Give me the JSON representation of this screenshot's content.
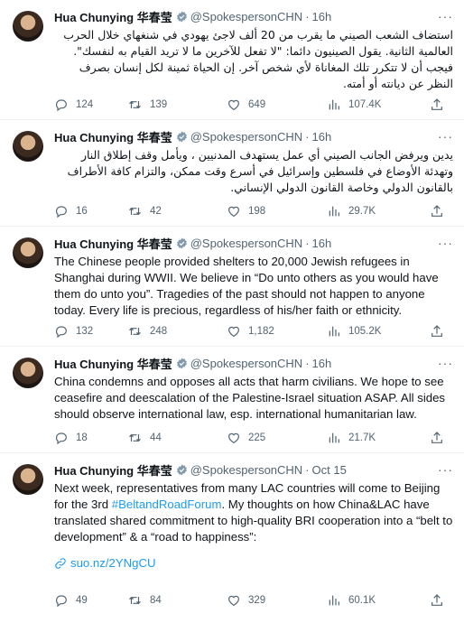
{
  "tweets": [
    {
      "name": "Hua Chunying 华春莹",
      "handle": "@SpokespersonCHN",
      "time": "16h",
      "text": "استضاف الشعب الصيني ما يقرب من 20 ألف لاجئ يهودي في شنغهاي خلال الحرب العالمية الثانية. يقول الصينيون دائما: \"لا تفعل للآخرين ما لا تريد القيام به لنفسك\". فيجب أن لا تتكرر تلك المغاناة لأي شخص آخر. إن الحياة ثمينة لكل إنسان بصرف النظر عن ديانته أو أمته.",
      "replies": "124",
      "reposts": "139",
      "likes": "649",
      "views": "107.4K"
    },
    {
      "name": "Hua Chunying 华春莹",
      "handle": "@SpokespersonCHN",
      "time": "16h",
      "text": "يدين ويرفض الجانب الصيني أي عمل يستهدف المدنيين ، ويأمل وقف إطلاق النار وتهدئة الأوضاع في فلسطين وإسرائيل في أسرع وقت ممكن، والتزام كافة الأطراف بالقانون الدولي وخاصة القانون الدولي الإنساني.",
      "replies": "16",
      "reposts": "42",
      "likes": "198",
      "views": "29.7K"
    },
    {
      "name": "Hua Chunying 华春莹",
      "handle": "@SpokespersonCHN",
      "time": "16h",
      "text": "The Chinese people provided shelters to 20,000 Jewish refugees in Shanghai during WWII. We believe in “Do unto others as you would have them do unto you”. Tragedies of the past should not happen to anyone today. Every life is precious, regardless of his/her faith or ethnicity.",
      "replies": "132",
      "reposts": "248",
      "likes": "1,182",
      "views": "105.2K"
    },
    {
      "name": "Hua Chunying 华春莹",
      "handle": "@SpokespersonCHN",
      "time": "16h",
      "text": "China condemns and opposes all acts that harm civilians. We hope to see ceasefire and deescalation of the Palestine-Israel situation ASAP. All sides should observe international law, esp. international humanitarian law.",
      "replies": "18",
      "reposts": "44",
      "likes": "225",
      "views": "21.7K"
    },
    {
      "name": "Hua Chunying 华春莹",
      "handle": "@SpokespersonCHN",
      "time": "Oct 15",
      "text_before": "Next week, representatives from many LAC countries will come to Beijing for the 3rd ",
      "hashtag": "#BeltandRoadForum",
      "text_after": ". My thoughts on how China&LAC have translated shared commitment to high-quality BRI cooperation into a “belt to development” & a “road to happiness”:",
      "link": "suo.nz/2YNgCU",
      "replies": "49",
      "reposts": "84",
      "likes": "329",
      "views": "60.1K"
    }
  ],
  "colors": {
    "accent": "#1d9bf0",
    "muted": "#536471",
    "text": "#0f1419"
  },
  "icons": [
    "verified-badge-icon",
    "more-icon",
    "reply-icon",
    "repost-icon",
    "like-icon",
    "views-icon",
    "share-icon",
    "link-icon"
  ]
}
